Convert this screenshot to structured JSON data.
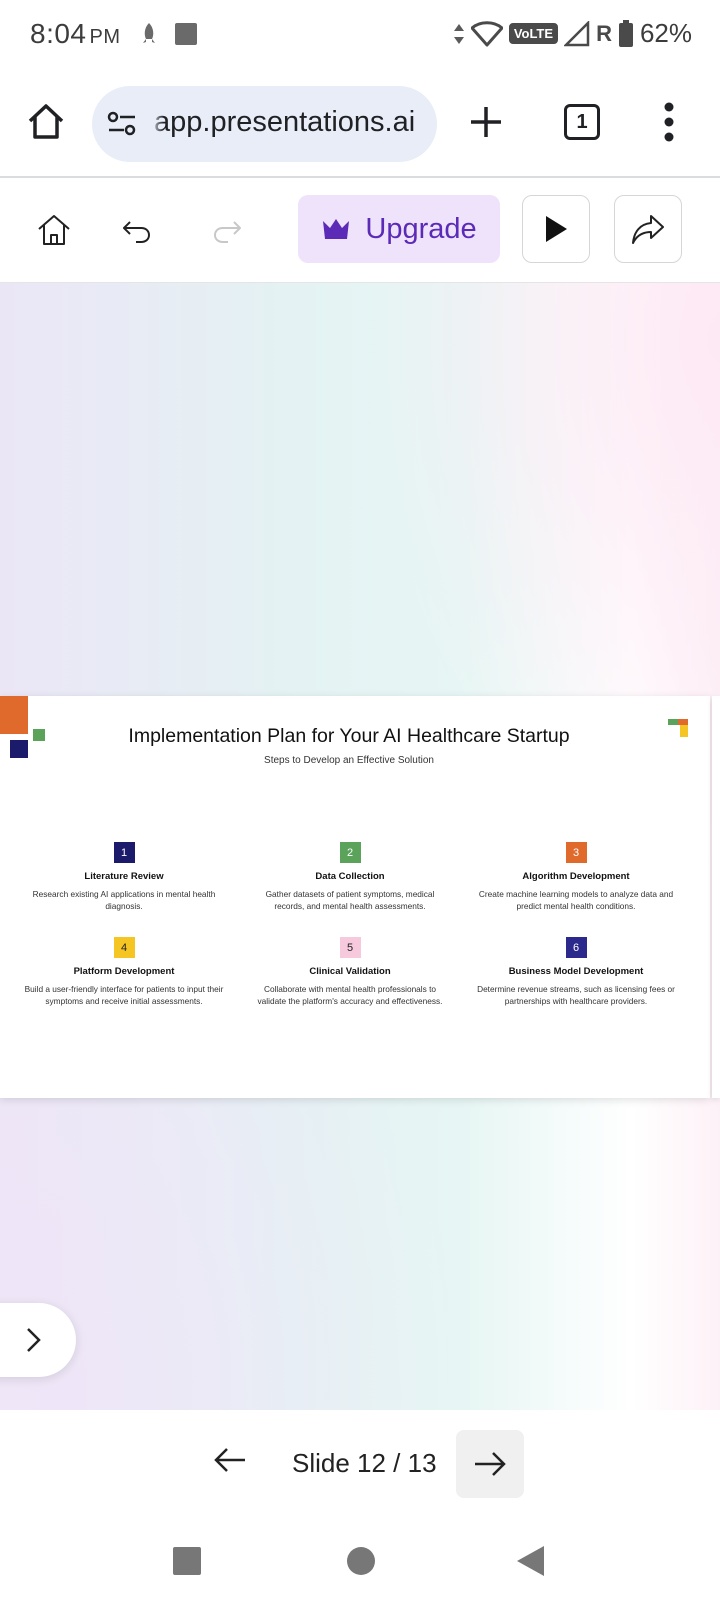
{
  "status_bar": {
    "time": "8:04",
    "ampm": "PM",
    "network": "VoLTE",
    "roaming": "R",
    "battery": "62%"
  },
  "browser": {
    "url": "app.presentations.ai",
    "tab_count": "1"
  },
  "toolbar": {
    "upgrade_label": "Upgrade"
  },
  "slide": {
    "title": "Implementation Plan for Your AI Healthcare Startup",
    "subtitle": "Steps to Develop an Effective Solution",
    "steps": [
      {
        "num": "1",
        "title": "Literature Review",
        "desc": "Research existing AI applications in mental health diagnosis.",
        "color": "#1c1a6b",
        "text_color": "#ffffff"
      },
      {
        "num": "2",
        "title": "Data Collection",
        "desc": "Gather datasets of patient symptoms, medical records, and mental health assessments.",
        "color": "#5ba35a",
        "text_color": "#ffffff"
      },
      {
        "num": "3",
        "title": "Algorithm Development",
        "desc": "Create machine learning models to analyze data and predict mental health conditions.",
        "color": "#e06a2c",
        "text_color": "#ffffff"
      },
      {
        "num": "4",
        "title": "Platform Development",
        "desc": "Build a user-friendly interface for patients to input their symptoms and receive initial assessments.",
        "color": "#f5c623",
        "text_color": "#222222"
      },
      {
        "num": "5",
        "title": "Clinical Validation",
        "desc": "Collaborate with mental health professionals to validate the platform's accuracy and effectiveness.",
        "color": "#f7c9dc",
        "text_color": "#222222"
      },
      {
        "num": "6",
        "title": "Business Model Development",
        "desc": "Determine revenue streams, such as licensing fees or partnerships with healthcare providers.",
        "color": "#2b2a8c",
        "text_color": "#ffffff"
      }
    ]
  },
  "navigation": {
    "slide_counter": "Slide 12 / 13"
  }
}
